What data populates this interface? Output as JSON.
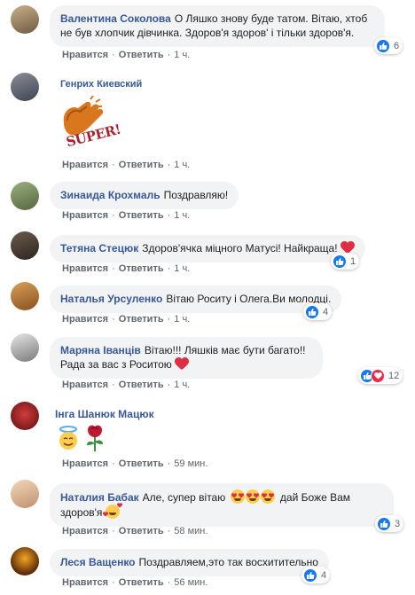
{
  "reply_label": "Ответить",
  "like_label": "Нравится",
  "separator": "·",
  "comments": [
    {
      "author": "Валентина Соколова",
      "text": "О Ляшко знову буде татом. Вітаю, хтоб не був хлопчик дівчинка. Здоров'я здоров' і тільки здоров'я.",
      "time": "1 ч.",
      "reaction_count": "6",
      "reactions": [
        "like"
      ]
    },
    {
      "author": "Генрих Киевский",
      "text": "",
      "sticker_text": "SUPER!",
      "time": "1 ч."
    },
    {
      "author": "Зинаида Крохмаль",
      "text": "Поздравляю!",
      "time": "1 ч."
    },
    {
      "author": "Тетяна Стецюк",
      "text": "Здоров'ячка міцного Матусі! Найкраща!",
      "time": "1 ч.",
      "reaction_count": "1",
      "reactions": [
        "like"
      ]
    },
    {
      "author": "Наталья Урсуленко",
      "text": "Вітаю Роситу і Олега.Ви молодці.",
      "time": "1 ч.",
      "reaction_count": "4",
      "reactions": [
        "like"
      ]
    },
    {
      "author": "Маряна Іванців",
      "text": "Вітаю!!! Ляшків має бути багато!! Рада за вас з Роситою",
      "time": "1 ч.",
      "reaction_count": "12",
      "reactions": [
        "like",
        "love"
      ]
    },
    {
      "author": "Інга Шанюк Мацюк",
      "text": "",
      "time": "59 мин."
    },
    {
      "author": "Наталия Бабак",
      "text": "Але, супер вітаю",
      "text_after": "дай Боже Вам здоров'я",
      "time": "58 мин.",
      "reaction_count": "3",
      "reactions": [
        "like"
      ]
    },
    {
      "author": "Леся Ващенко",
      "text": "Поздравляем,это так восхитительно",
      "time": "56 мин.",
      "reaction_count": "4",
      "reactions": [
        "like"
      ]
    }
  ],
  "colors": {
    "author": "#385898",
    "bubble": "#f2f3f5",
    "like": "#1877f2",
    "love": "#f0284a",
    "meta": "#606770"
  }
}
